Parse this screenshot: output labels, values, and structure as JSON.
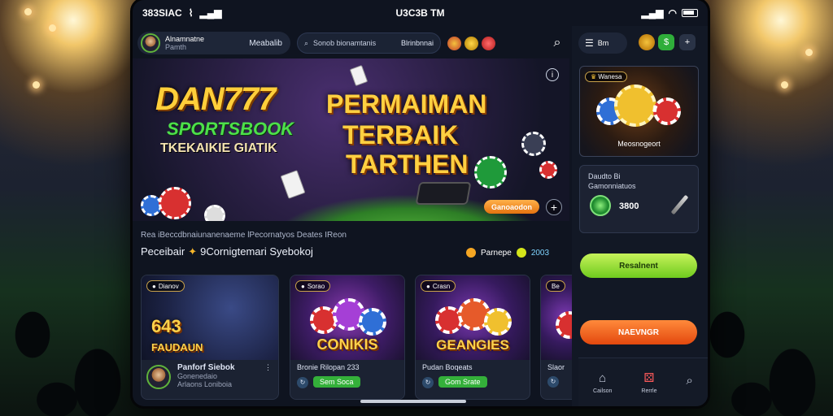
{
  "status": {
    "carrier": "383SIAC",
    "time": "U3C3B TM"
  },
  "profile": {
    "name": "Alnamnatne",
    "sub": "Pamth",
    "badge": "Meabalib"
  },
  "search": {
    "placeholder": "Sonob bionamtanis",
    "tag": "Blrinbnnai"
  },
  "banner": {
    "brand": "DAN777",
    "brand_sub": "SPORTSBOOK",
    "brand_tag": "TKEKAIKIE GIATIK",
    "headline_1": "PERMAIMAN",
    "headline_2": "TERBAIK",
    "headline_3": "TARTHEN",
    "cta": "Ganoaodon"
  },
  "ticker": "Rea iBeccdbnaiunanenaeme lPecornatyos Deates IReon",
  "section": {
    "title": "Peceibair",
    "subtitle": "9Cornigtemari Syebokoj"
  },
  "stats": {
    "label": "Parnepe",
    "value": "2003"
  },
  "games": [
    {
      "tag": "Dianov",
      "title": "643",
      "title_sub": "FAUDAUN",
      "footer_title": "Panforf Siebok",
      "footer_sub": "Gonenedaio Arlaons Loniboia"
    },
    {
      "tag": "Sorao",
      "title": "CONIKIS",
      "footer_title": "Bronie Rilopan ",
      "footer_val": "233",
      "button": "Sem Soca"
    },
    {
      "tag": "Crasn",
      "title": "GEANGIES",
      "footer_title": "Pudan Boqeats",
      "button": "Gom Srate"
    },
    {
      "tag": "Be",
      "title": "",
      "footer_title": "Slaor"
    }
  ],
  "right": {
    "menu_label": "Bm",
    "promo_tag": "Wanesa",
    "promo_name": "Meosnogeort",
    "wallet_title": "Daudto Bi",
    "wallet_sub": "Gamonniatuos",
    "wallet_amount": "3800",
    "btn_primary": "Resalnent",
    "btn_secondary": "NAEVNGR"
  },
  "tabs": [
    {
      "icon": "home-icon",
      "label": "Cailson"
    },
    {
      "icon": "dice-icon",
      "label": "Rerrle"
    },
    {
      "icon": "search-icon",
      "label": ""
    }
  ],
  "colors": {
    "accent_green": "#6fcb1e",
    "accent_orange": "#e3480e",
    "gold": "#ffd041"
  }
}
